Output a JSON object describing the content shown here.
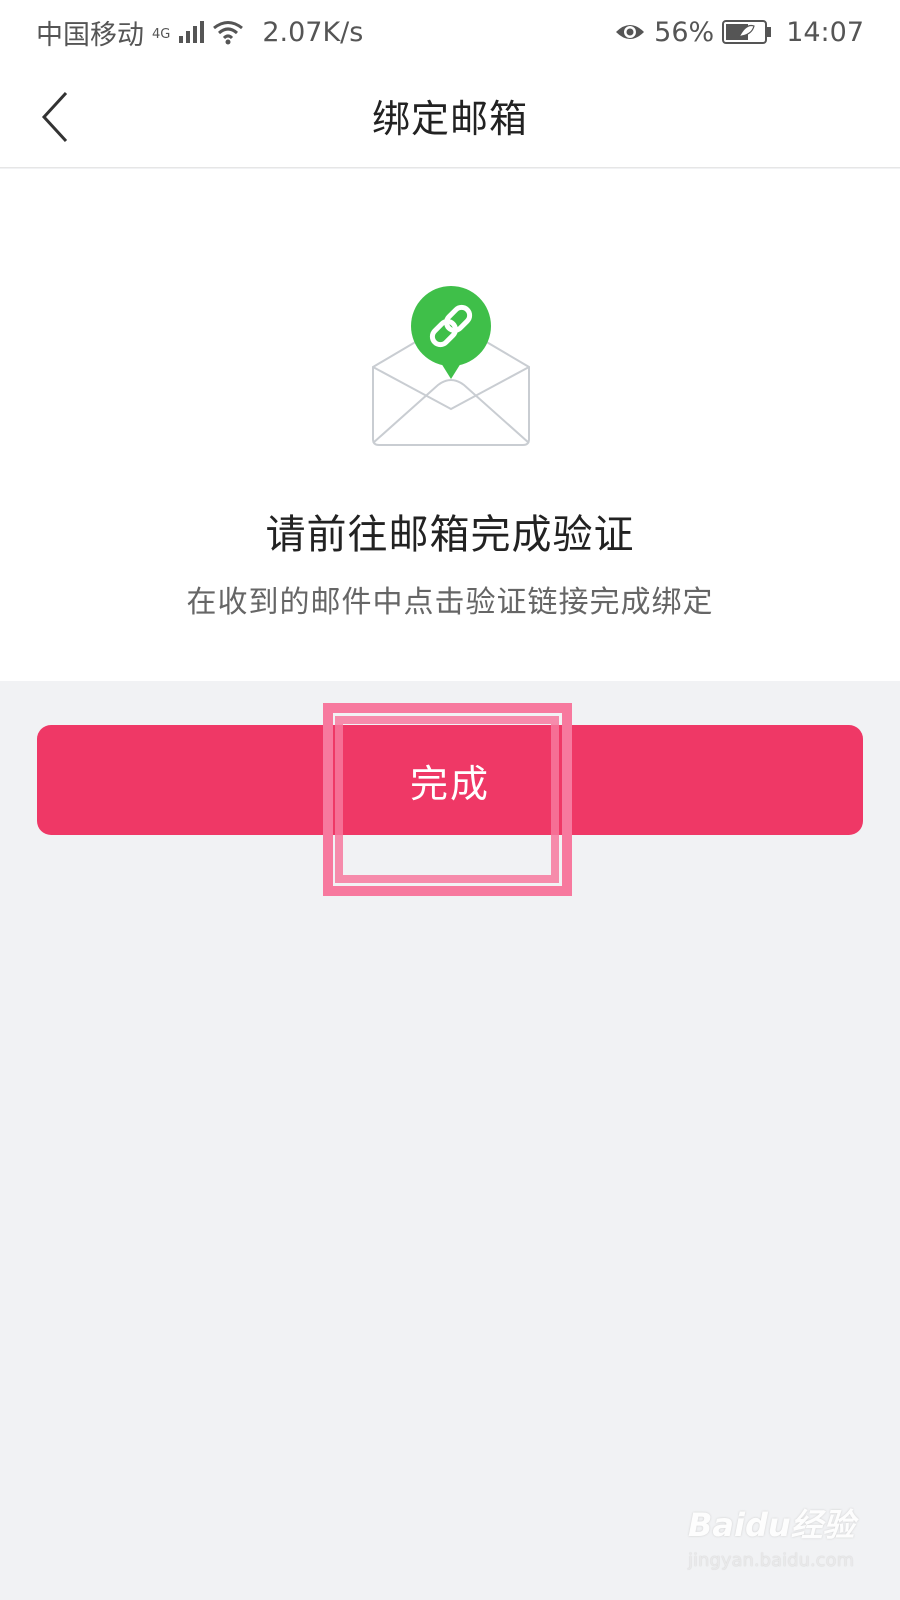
{
  "status_bar": {
    "carrier": "中国移动",
    "network_type": "4G",
    "net_speed": "2.07K/s",
    "battery": "56%",
    "time": "14:07"
  },
  "nav": {
    "title": "绑定邮箱",
    "back_icon": "chevron-left-icon"
  },
  "content": {
    "illustration_icon": "envelope-link-icon",
    "main_message": "请前往邮箱完成验证",
    "sub_message": "在收到的邮件中点击验证链接完成绑定"
  },
  "actions": {
    "done_label": "完成"
  },
  "watermark": {
    "brand": "Baidu经验",
    "url": "jingyan.baidu.com"
  },
  "colors": {
    "primary_button": "#ef3866",
    "link_badge": "#3fbf49",
    "highlight": "#f7799e",
    "background": "#f1f2f4"
  }
}
